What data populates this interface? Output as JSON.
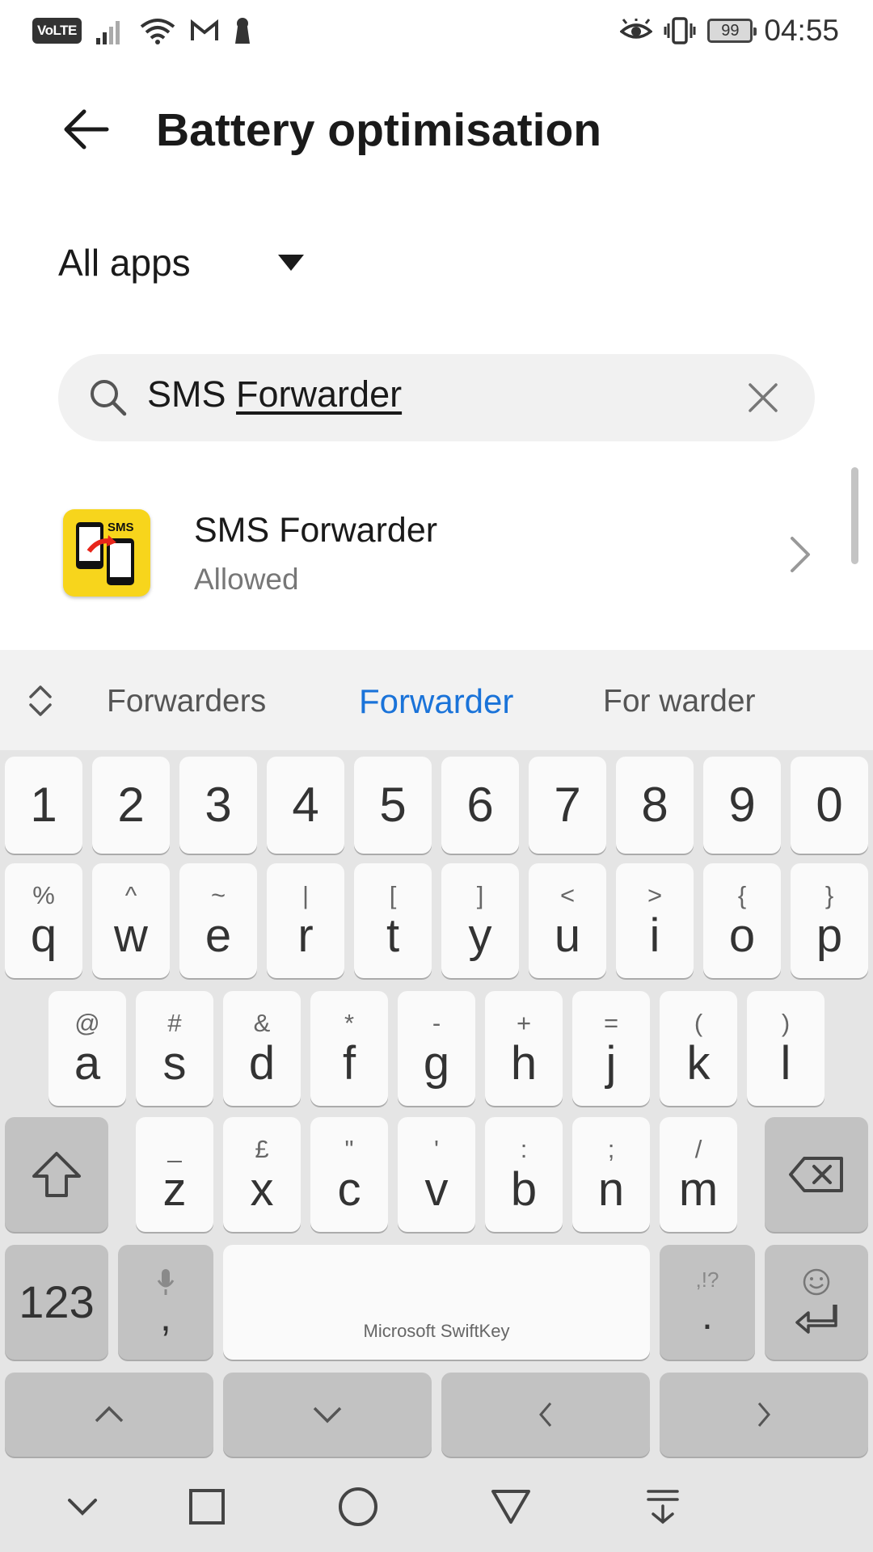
{
  "status_bar": {
    "volte": "VoLTE",
    "battery": "99",
    "time": "04:55"
  },
  "header": {
    "title": "Battery optimisation"
  },
  "filter": {
    "label": "All apps"
  },
  "search": {
    "prefix": "SMS ",
    "underlined": "Forwarder"
  },
  "results": [
    {
      "name": "SMS Forwarder",
      "status": "Allowed",
      "icon_label": "SMS"
    }
  ],
  "keyboard": {
    "suggestions": [
      "Forwarders",
      "Forwarder",
      "For warder"
    ],
    "number_row": [
      "1",
      "2",
      "3",
      "4",
      "5",
      "6",
      "7",
      "8",
      "9",
      "0"
    ],
    "row1": [
      {
        "alt": "%",
        "main": "q"
      },
      {
        "alt": "^",
        "main": "w"
      },
      {
        "alt": "~",
        "main": "e"
      },
      {
        "alt": "|",
        "main": "r"
      },
      {
        "alt": "[",
        "main": "t"
      },
      {
        "alt": "]",
        "main": "y"
      },
      {
        "alt": "<",
        "main": "u"
      },
      {
        "alt": ">",
        "main": "i"
      },
      {
        "alt": "{",
        "main": "o"
      },
      {
        "alt": "}",
        "main": "p"
      }
    ],
    "row2": [
      {
        "alt": "@",
        "main": "a"
      },
      {
        "alt": "#",
        "main": "s"
      },
      {
        "alt": "&",
        "main": "d"
      },
      {
        "alt": "*",
        "main": "f"
      },
      {
        "alt": "-",
        "main": "g"
      },
      {
        "alt": "+",
        "main": "h"
      },
      {
        "alt": "=",
        "main": "j"
      },
      {
        "alt": "(",
        "main": "k"
      },
      {
        "alt": ")",
        "main": "l"
      }
    ],
    "row3": [
      {
        "alt": "_",
        "main": "z"
      },
      {
        "alt": "£",
        "main": "x"
      },
      {
        "alt": "\"",
        "main": "c"
      },
      {
        "alt": "'",
        "main": "v"
      },
      {
        "alt": ":",
        "main": "b"
      },
      {
        "alt": ";",
        "main": "n"
      },
      {
        "alt": "/",
        "main": "m"
      }
    ],
    "symbols_key": "123",
    "comma_key": ",",
    "space_label": "Microsoft SwiftKey",
    "period_alt": ",!?",
    "period_key": "."
  }
}
